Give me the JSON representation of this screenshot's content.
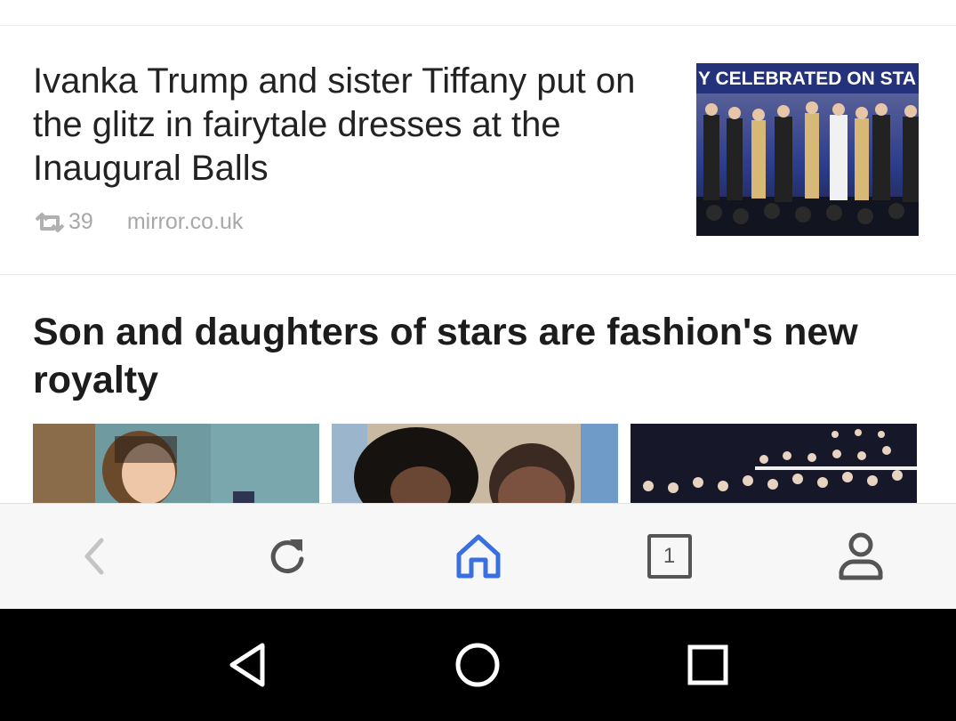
{
  "articles": [
    {
      "headline": "Ivanka Trump and sister Tiffany put on the glitz in fairytale dresses at the Inaugural Balls",
      "shares": "39",
      "source": "mirror.co.uk",
      "thumbnail_caption": "Y CELEBRATED ON STA"
    },
    {
      "headline": "Son and daughters of stars are fashion's new royalty"
    }
  ],
  "bottom_bar": {
    "tabs_count": "1",
    "accent_color": "#3a6fe0",
    "icon_color": "#555555",
    "items": [
      "back-icon",
      "reload-icon",
      "home-icon",
      "tabs-icon",
      "profile-icon"
    ]
  },
  "system_nav": {
    "items": [
      "back-triangle-icon",
      "home-circle-icon",
      "recents-square-icon"
    ]
  }
}
